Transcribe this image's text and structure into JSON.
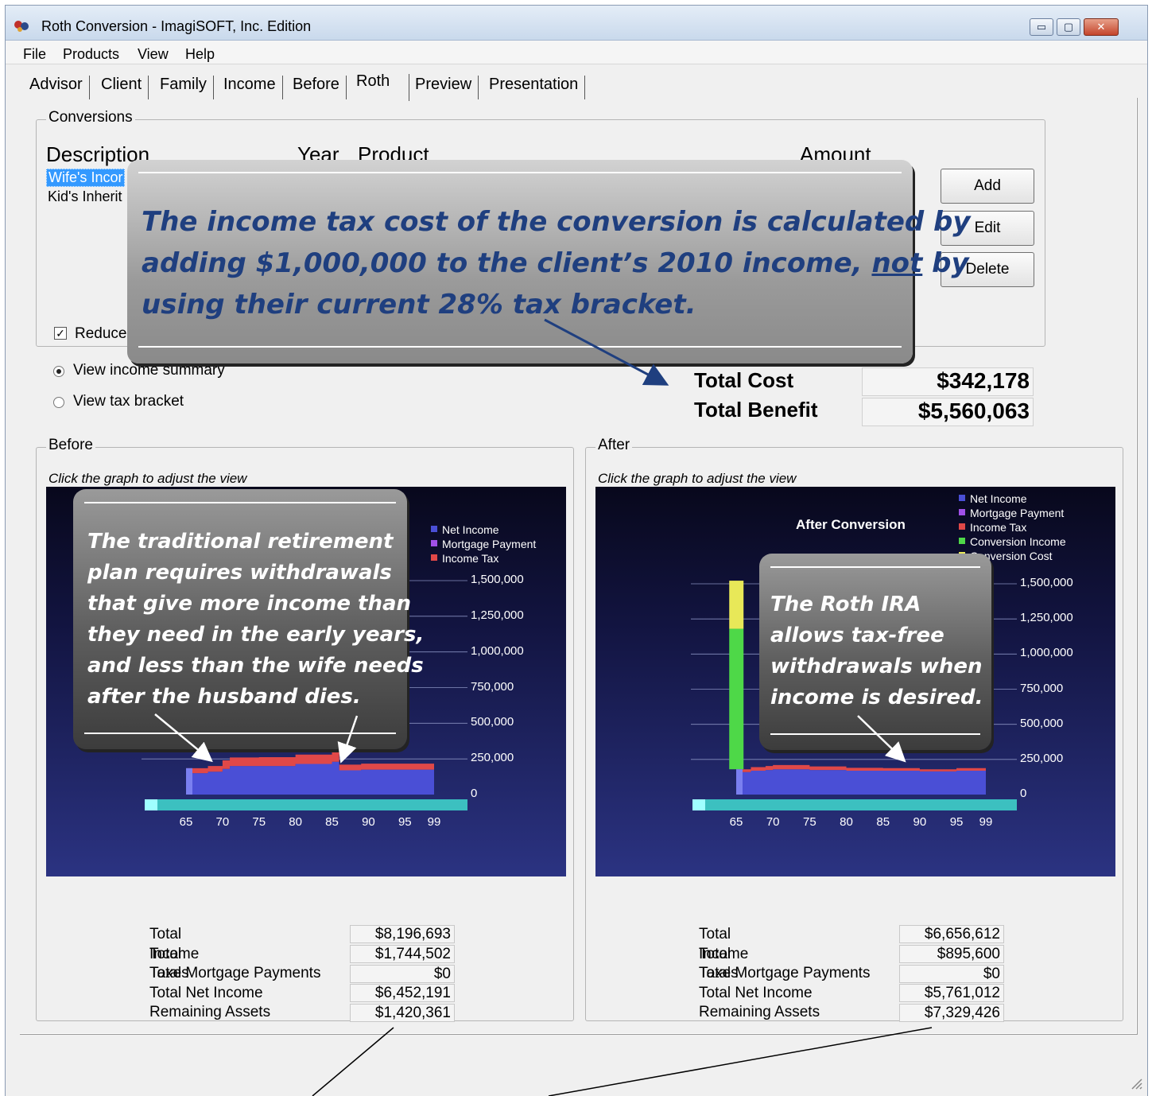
{
  "window": {
    "title": "Roth Conversion - ImagiSOFT, Inc. Edition",
    "min": "▭",
    "max": "▢",
    "close": "✕"
  },
  "menu": [
    "File",
    "Products",
    "View",
    "Help"
  ],
  "tabs": [
    "Advisor",
    "Client",
    "Family",
    "Income",
    "Before",
    "Roth",
    "Preview",
    "Presentation"
  ],
  "active_tab": "Roth",
  "conversions": {
    "group_label": "Conversions",
    "columns": {
      "description": "Description",
      "year": "Year",
      "product": "Product",
      "amount": "Amount"
    },
    "rows": [
      "Wife's Incor",
      "Kid's Inherit"
    ],
    "buttons": {
      "add": "Add",
      "edit": "Edit",
      "delete": "Delete"
    },
    "reduce_label": "Reduce",
    "reduce_checked": true
  },
  "view_options": {
    "income_summary": "View income summary",
    "tax_bracket": "View tax bracket",
    "selected": "income_summary"
  },
  "totals": {
    "cost_label": "Total Cost",
    "cost_value": "$342,178",
    "benefit_label": "Total Benefit",
    "benefit_value": "$5,560,063"
  },
  "before": {
    "group_label": "Before",
    "hint": "Click the graph to adjust the view",
    "legend": [
      "Net Income",
      "Mortgage Payment",
      "Income Tax"
    ],
    "chart_title": "",
    "summary_labels": [
      "Total Income",
      "Total Taxes",
      "Total Mortgage Payments",
      "Total Net Income",
      "Remaining Assets"
    ],
    "summary_values": [
      "$8,196,693",
      "$1,744,502",
      "$0",
      "$6,452,191",
      "$1,420,361"
    ]
  },
  "after": {
    "group_label": "After",
    "hint": "Click the graph to adjust the view",
    "chart_title": "After Conversion",
    "legend": [
      "Net Income",
      "Mortgage Payment",
      "Income Tax",
      "Conversion Income",
      "Conversion Cost"
    ],
    "summary_labels": [
      "Total Income",
      "Total Taxes",
      "Total Mortgage Payments",
      "Total Net Income",
      "Remaining Assets"
    ],
    "summary_values": [
      "$6,656,612",
      "$895,600",
      "$0",
      "$5,761,012",
      "$7,329,426"
    ]
  },
  "callouts": {
    "main_lines": [
      "The income tax cost of the conversion is calculated by",
      "adding $1,000,000 to the client’s 2010 income, ",
      "using their current 28% tax bracket."
    ],
    "main_not": "not",
    "main_by": " by",
    "before_lines": [
      "The traditional retirement",
      "plan requires withdrawals",
      "that give more income than",
      "they need in the early years,",
      "and less than the wife needs",
      "after the husband dies."
    ],
    "after_lines": [
      "The Roth IRA",
      "allows tax-free",
      "withdrawals when",
      "income is desired."
    ]
  },
  "colors": {
    "net_income": "#4a4fd6",
    "mortgage": "#a050e8",
    "income_tax": "#e04848",
    "conversion_income": "#4ed848",
    "conversion_cost": "#e8e858",
    "floor": "#3cc0c0",
    "callout_text_main": "#1f3f7f"
  },
  "chart_data": [
    {
      "type": "area",
      "title": "",
      "x_ticks": [
        "65",
        "70",
        "75",
        "80",
        "85",
        "90",
        "95",
        "99"
      ],
      "y_ticks": [
        "1,500,000",
        "1,250,000",
        "1,000,000",
        "750,000",
        "500,000",
        "250,000",
        "0"
      ],
      "ylim": [
        0,
        1500000
      ],
      "x": [
        65,
        67,
        68,
        70,
        71,
        75,
        80,
        85,
        86,
        89,
        95,
        99
      ],
      "series": [
        {
          "name": "Net Income",
          "values": [
            150000,
            150000,
            160000,
            180000,
            200000,
            200000,
            215000,
            230000,
            170000,
            175000,
            175000,
            170000
          ]
        },
        {
          "name": "Income Tax",
          "values": [
            35000,
            35000,
            40000,
            60000,
            60000,
            62000,
            65000,
            70000,
            40000,
            42000,
            42000,
            40000
          ]
        }
      ]
    },
    {
      "type": "area",
      "title": "After Conversion",
      "x_ticks": [
        "65",
        "70",
        "75",
        "80",
        "85",
        "90",
        "95",
        "99"
      ],
      "y_ticks": [
        "1,500,000",
        "1,250,000",
        "1,000,000",
        "750,000",
        "500,000",
        "250,000",
        "0"
      ],
      "ylim": [
        0,
        1500000
      ],
      "x": [
        65,
        66,
        67,
        69,
        70,
        75,
        80,
        85,
        90,
        95,
        99
      ],
      "series": [
        {
          "name": "Net Income",
          "values": [
            160000,
            160000,
            170000,
            175000,
            180000,
            175000,
            170000,
            170000,
            165000,
            170000,
            170000
          ]
        },
        {
          "name": "Income Tax",
          "values": [
            20000,
            20000,
            25000,
            28000,
            30000,
            25000,
            20000,
            18000,
            15000,
            18000,
            18000
          ]
        },
        {
          "name": "Conversion Income",
          "values": [
            0,
            1000000,
            0,
            0,
            0,
            0,
            0,
            0,
            0,
            0,
            0
          ]
        },
        {
          "name": "Conversion Cost",
          "values": [
            0,
            342178,
            0,
            0,
            0,
            0,
            0,
            0,
            0,
            0,
            0
          ]
        }
      ]
    }
  ]
}
